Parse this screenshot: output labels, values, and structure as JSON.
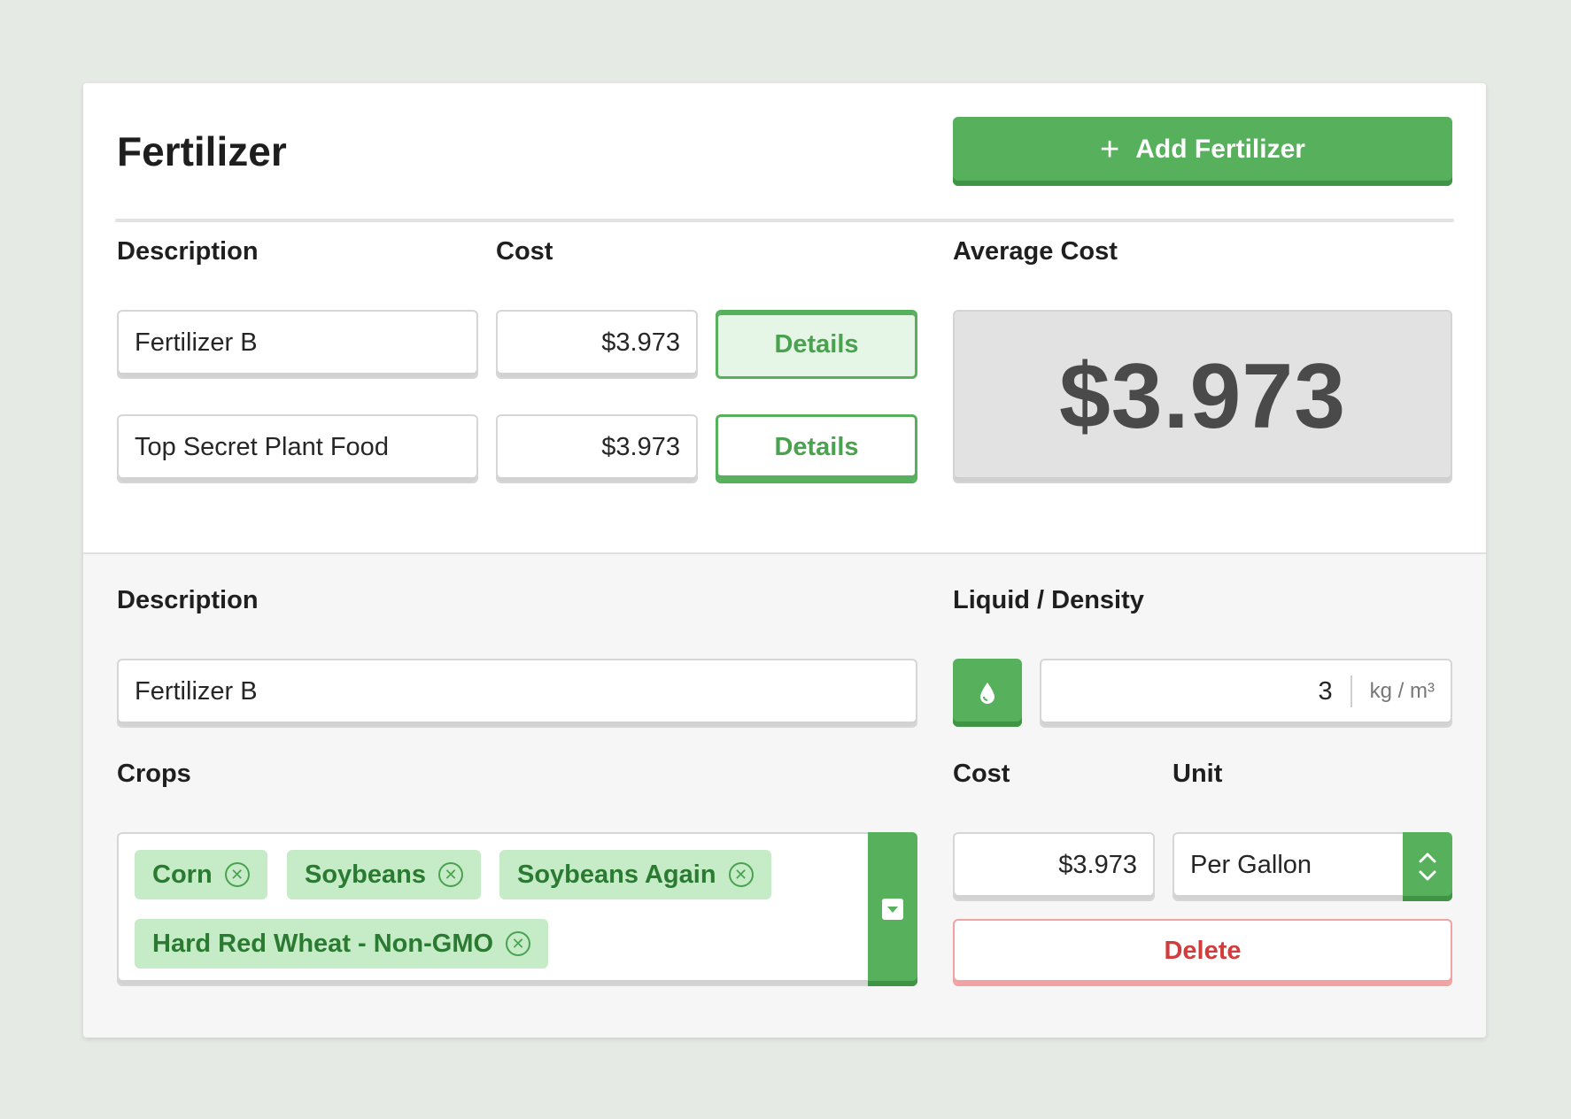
{
  "header": {
    "title": "Fertilizer",
    "add_button_label": "Add Fertilizer",
    "add_button_icon": "plus-icon"
  },
  "list": {
    "description_label": "Description",
    "cost_label": "Cost",
    "average_cost_label": "Average Cost",
    "average_cost_value": "$3.973",
    "rows": [
      {
        "description": "Fertilizer B",
        "cost": "$3.973",
        "details_label": "Details",
        "selected": true
      },
      {
        "description": "Top Secret Plant Food",
        "cost": "$3.973",
        "details_label": "Details",
        "selected": false
      }
    ]
  },
  "editor": {
    "description_label": "Description",
    "description_value": "Fertilizer B",
    "liquid_density_label": "Liquid / Density",
    "liquid_icon": "droplet-icon",
    "density_value": "3",
    "density_unit": "kg / m³",
    "crops_label": "Crops",
    "crops": [
      "Corn",
      "Soybeans",
      "Soybeans Again",
      "Hard Red Wheat - Non-GMO"
    ],
    "cost_label": "Cost",
    "cost_value": "$3.973",
    "unit_label": "Unit",
    "unit_value": "Per Gallon",
    "delete_label": "Delete"
  },
  "colors": {
    "accent": "#57b05c",
    "accent_dark": "#3f9545",
    "chip_bg": "#c6ebc7",
    "chip_text": "#2b7a31",
    "danger": "#d23c3c",
    "background": "#e6eae5"
  }
}
